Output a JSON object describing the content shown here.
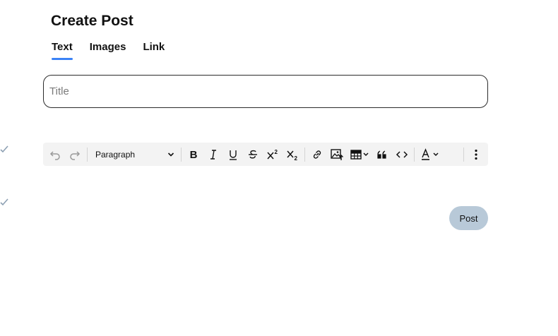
{
  "page": {
    "title": "Create Post"
  },
  "tabs": [
    {
      "label": "Text",
      "active": true
    },
    {
      "label": "Images",
      "active": false
    },
    {
      "label": "Link",
      "active": false
    }
  ],
  "title_field": {
    "placeholder": "Title",
    "value": ""
  },
  "toolbar": {
    "block_type": "Paragraph",
    "buttons": [
      "undo-icon",
      "redo-icon",
      "bold-icon",
      "italic-icon",
      "underline-icon",
      "strikethrough-icon",
      "superscript-icon",
      "subscript-icon",
      "link-icon",
      "insert-image-icon",
      "table-icon",
      "quote-icon",
      "code-icon",
      "text-color-icon",
      "more-options-icon"
    ]
  },
  "actions": {
    "post_label": "Post"
  },
  "colors": {
    "tab_underline": "#3b82f6",
    "post_button_bg": "#b8c9d8",
    "toolbar_bg": "#f3f3f3",
    "check_mark": "#8da0b3"
  }
}
